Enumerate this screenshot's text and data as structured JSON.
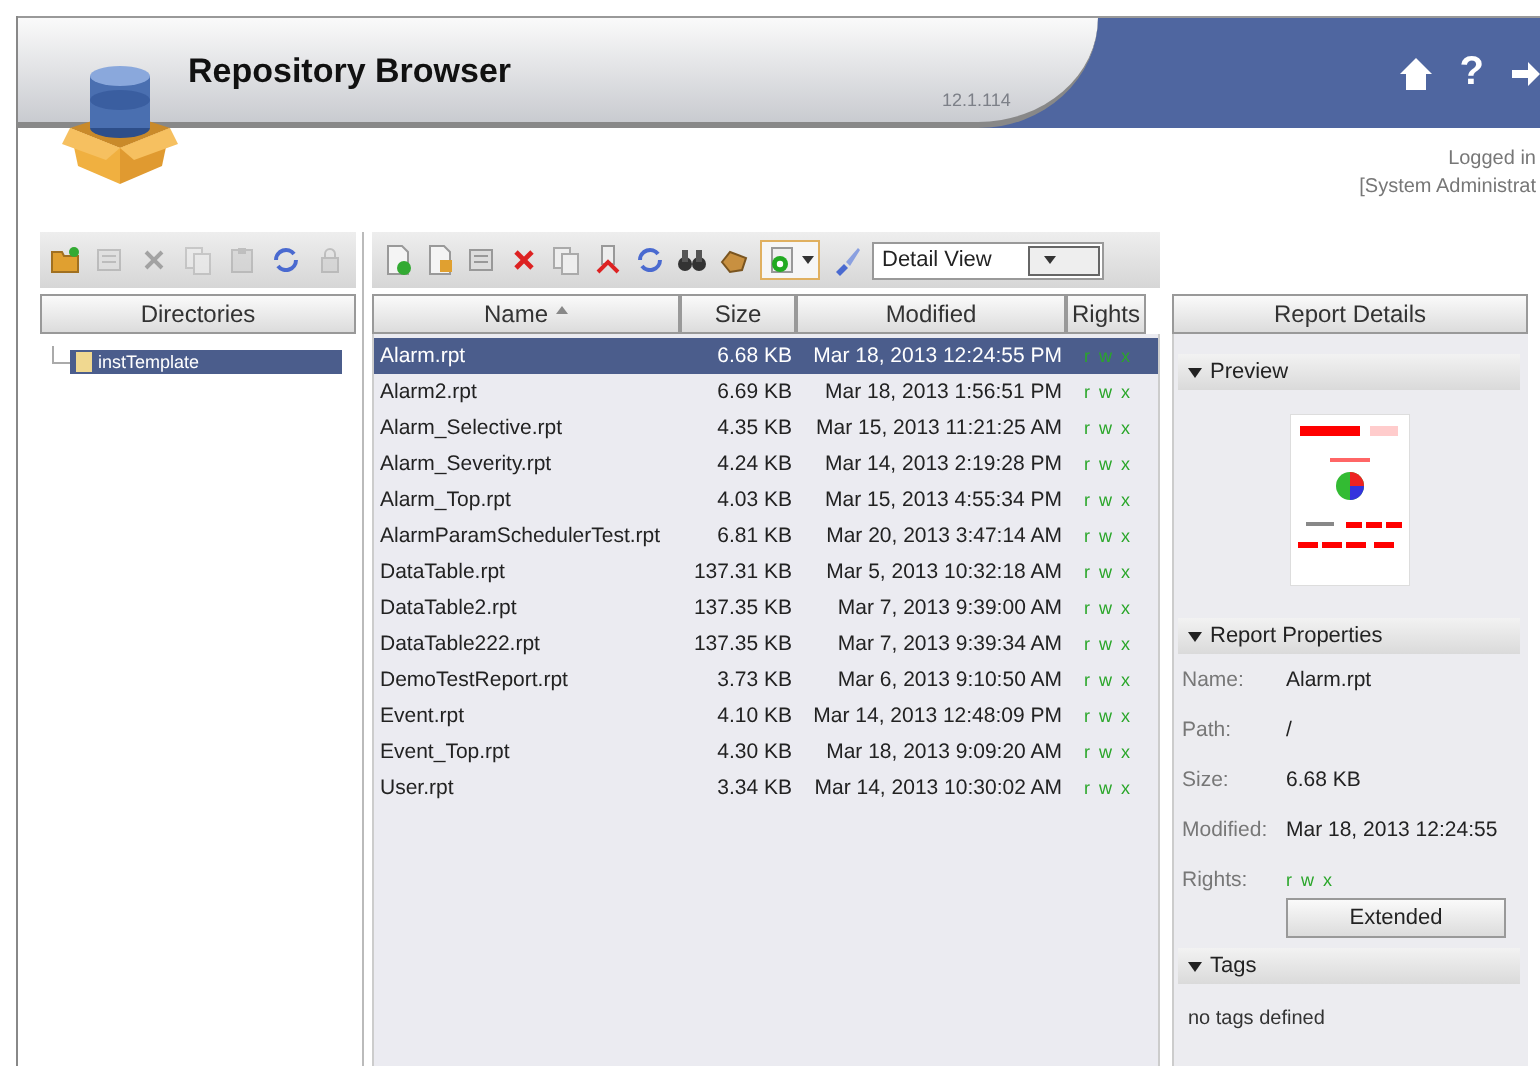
{
  "header": {
    "title": "Repository Browser",
    "version": "12.1.114",
    "login_label": "Logged in",
    "user": "[System Administrat",
    "help_label": "?"
  },
  "directories": {
    "heading": "Directories",
    "tree": [
      {
        "label": "instTemplate",
        "selected": true
      }
    ]
  },
  "files": {
    "view_select": "Detail View",
    "columns": [
      {
        "label": "Name",
        "sorted": true
      },
      {
        "label": "Size",
        "sorted": false
      },
      {
        "label": "Modified",
        "sorted": false
      },
      {
        "label": "Rights",
        "sorted": false
      }
    ],
    "rows": [
      {
        "name": "Alarm.rpt",
        "size": "6.68 KB",
        "modified": "Mar 18, 2013 12:24:55 PM",
        "rights": "r w x",
        "selected": true
      },
      {
        "name": "Alarm2.rpt",
        "size": "6.69 KB",
        "modified": "Mar 18, 2013 1:56:51 PM",
        "rights": "r w x",
        "selected": false
      },
      {
        "name": "Alarm_Selective.rpt",
        "size": "4.35 KB",
        "modified": "Mar 15, 2013 11:21:25 AM",
        "rights": "r w x",
        "selected": false
      },
      {
        "name": "Alarm_Severity.rpt",
        "size": "4.24 KB",
        "modified": "Mar 14, 2013 2:19:28 PM",
        "rights": "r w x",
        "selected": false
      },
      {
        "name": "Alarm_Top.rpt",
        "size": "4.03 KB",
        "modified": "Mar 15, 2013 4:55:34 PM",
        "rights": "r w x",
        "selected": false
      },
      {
        "name": "AlarmParamSchedulerTest.rpt",
        "size": "6.81 KB",
        "modified": "Mar 20, 2013 3:47:14 AM",
        "rights": "r w x",
        "selected": false
      },
      {
        "name": "DataTable.rpt",
        "size": "137.31 KB",
        "modified": "Mar 5, 2013 10:32:18 AM",
        "rights": "r w x",
        "selected": false
      },
      {
        "name": "DataTable2.rpt",
        "size": "137.35 KB",
        "modified": "Mar 7, 2013 9:39:00 AM",
        "rights": "r w x",
        "selected": false
      },
      {
        "name": "DataTable222.rpt",
        "size": "137.35 KB",
        "modified": "Mar 7, 2013 9:39:34 AM",
        "rights": "r w x",
        "selected": false
      },
      {
        "name": "DemoTestReport.rpt",
        "size": "3.73 KB",
        "modified": "Mar 6, 2013 9:10:50 AM",
        "rights": "r w x",
        "selected": false
      },
      {
        "name": "Event.rpt",
        "size": "4.10 KB",
        "modified": "Mar 14, 2013 12:48:09 PM",
        "rights": "r w x",
        "selected": false
      },
      {
        "name": "Event_Top.rpt",
        "size": "4.30 KB",
        "modified": "Mar 18, 2013 9:09:20 AM",
        "rights": "r w x",
        "selected": false
      },
      {
        "name": "User.rpt",
        "size": "3.34 KB",
        "modified": "Mar 14, 2013 10:30:02 AM",
        "rights": "r w x",
        "selected": false
      }
    ]
  },
  "details": {
    "heading": "Report Details",
    "sections": [
      {
        "kind": "preview",
        "title": "Preview",
        "expanded": true
      },
      {
        "kind": "properties",
        "title": "Report Properties",
        "expanded": true,
        "items": [
          {
            "label": "Name:",
            "value": "Alarm.rpt",
            "kind": "text"
          },
          {
            "label": "Path:",
            "value": "/",
            "kind": "text"
          },
          {
            "label": "Size:",
            "value": "6.68 KB",
            "kind": "text"
          },
          {
            "label": "Modified:",
            "value": "Mar 18, 2013 12:24:55",
            "kind": "text"
          },
          {
            "label": "Rights:",
            "value": "r w x",
            "kind": "rights"
          }
        ],
        "button": "Extended"
      },
      {
        "kind": "tags",
        "title": "Tags",
        "expanded": true,
        "text": "no tags defined"
      }
    ]
  }
}
